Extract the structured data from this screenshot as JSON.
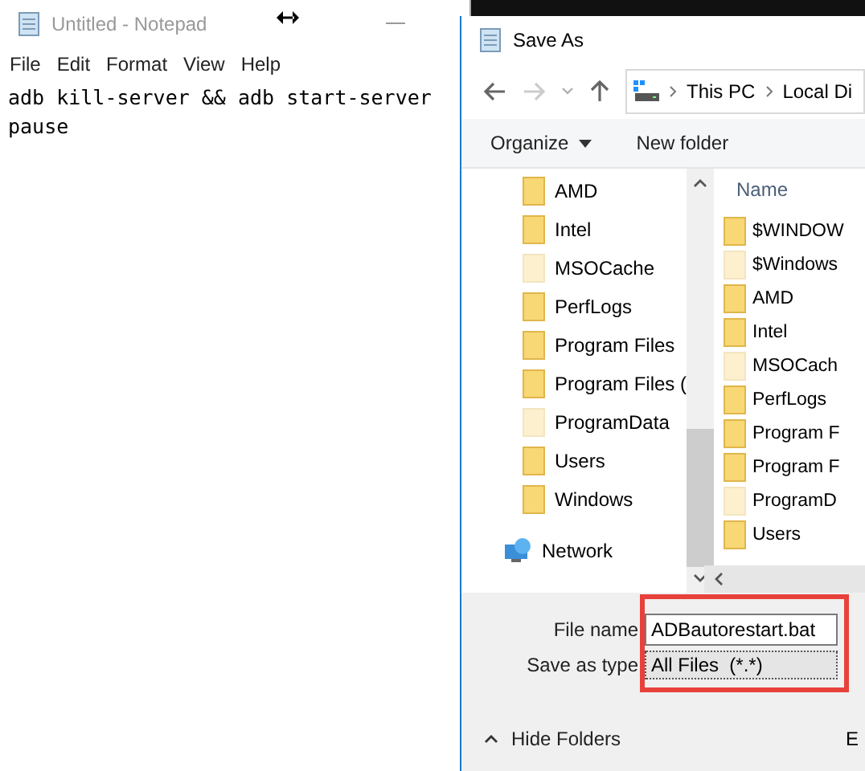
{
  "notepad": {
    "title": "Untitled - Notepad",
    "menu": [
      "File",
      "Edit",
      "Format",
      "View",
      "Help"
    ],
    "text_lines": [
      "adb kill-server && adb start-server",
      "pause"
    ]
  },
  "dialog": {
    "title": "Save As",
    "breadcrumb": [
      "This PC",
      "Local Di"
    ],
    "toolbar": {
      "organize": "Organize",
      "new_folder": "New folder"
    },
    "nav_items": [
      {
        "name": "AMD",
        "hidden": false
      },
      {
        "name": "Intel",
        "hidden": false
      },
      {
        "name": "MSOCache",
        "hidden": true
      },
      {
        "name": "PerfLogs",
        "hidden": false
      },
      {
        "name": "Program Files",
        "hidden": false
      },
      {
        "name": "Program Files (",
        "hidden": false
      },
      {
        "name": "ProgramData",
        "hidden": true
      },
      {
        "name": "Users",
        "hidden": false
      },
      {
        "name": "Windows",
        "hidden": false
      }
    ],
    "network": "Network",
    "list_header": "Name",
    "files": [
      {
        "name": "$WINDOW",
        "hidden": false
      },
      {
        "name": "$Windows",
        "hidden": true
      },
      {
        "name": "AMD",
        "hidden": false
      },
      {
        "name": "Intel",
        "hidden": false
      },
      {
        "name": "MSOCach",
        "hidden": true
      },
      {
        "name": "PerfLogs",
        "hidden": false
      },
      {
        "name": "Program F",
        "hidden": false
      },
      {
        "name": "Program F",
        "hidden": false
      },
      {
        "name": "ProgramD",
        "hidden": true
      },
      {
        "name": "Users",
        "hidden": false
      }
    ],
    "file_name_label": "File name",
    "file_name": "ADBautorestart.bat",
    "type_label": "Save as type",
    "type_value": "All Files  (*.*)",
    "hide_folders": "Hide Folders",
    "footer_cut": "E"
  }
}
